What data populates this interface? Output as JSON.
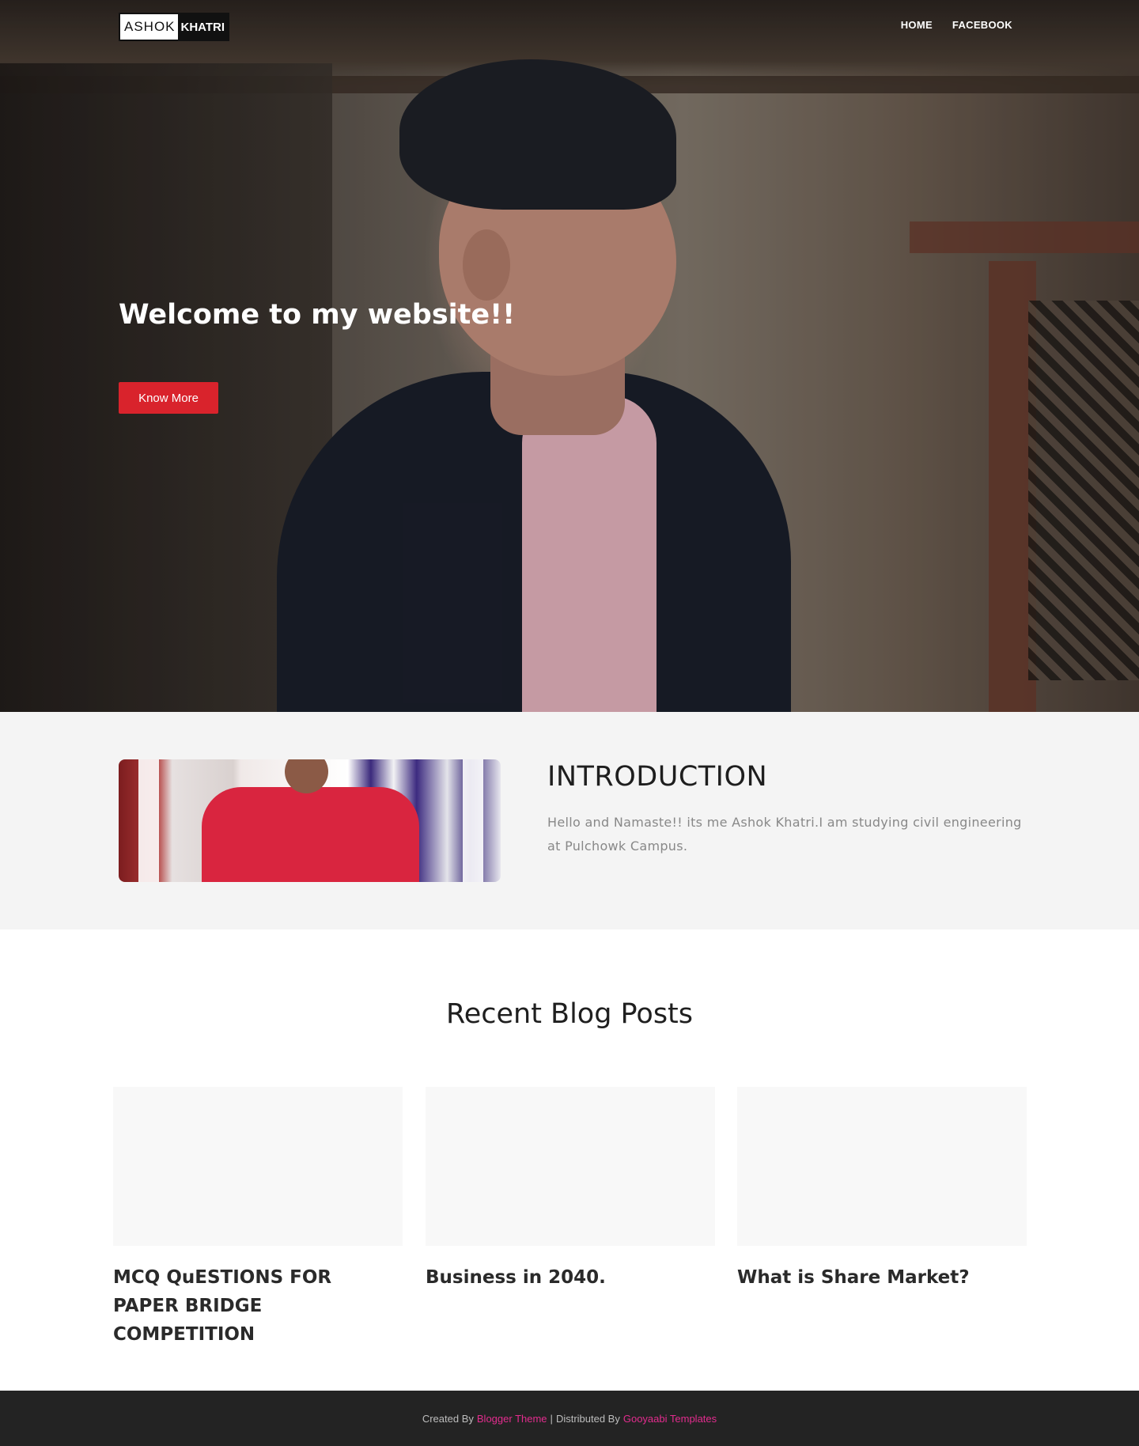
{
  "logo": {
    "part1": "ASHOK",
    "part2": "KHATRI"
  },
  "nav": {
    "items": [
      {
        "label": "HOME"
      },
      {
        "label": "FACEBOOK"
      }
    ]
  },
  "hero": {
    "title": "Welcome to my website!!",
    "button_label": "Know More"
  },
  "intro": {
    "title": "INTRODUCTION",
    "text": "Hello and Namaste!! its me Ashok Khatri.I am studying civil engineering at Pulchowk Campus."
  },
  "blog": {
    "heading": "Recent Blog Posts",
    "posts": [
      {
        "title": "MCQ QuESTIONS FOR PAPER BRIDGE COMPETITION"
      },
      {
        "title": "Business in 2040."
      },
      {
        "title": "What is Share Market?"
      }
    ]
  },
  "footer": {
    "created_by_text": "Created By",
    "created_by_link": "Blogger Theme",
    "separator": "|",
    "distributed_by_text": "Distributed By",
    "distributed_by_link": "Gooyaabi Templates"
  },
  "colors": {
    "accent_button": "#d9232c",
    "footer_link": "#e32c8e",
    "footer_bg": "#232323",
    "intro_bg": "#f4f4f4"
  }
}
